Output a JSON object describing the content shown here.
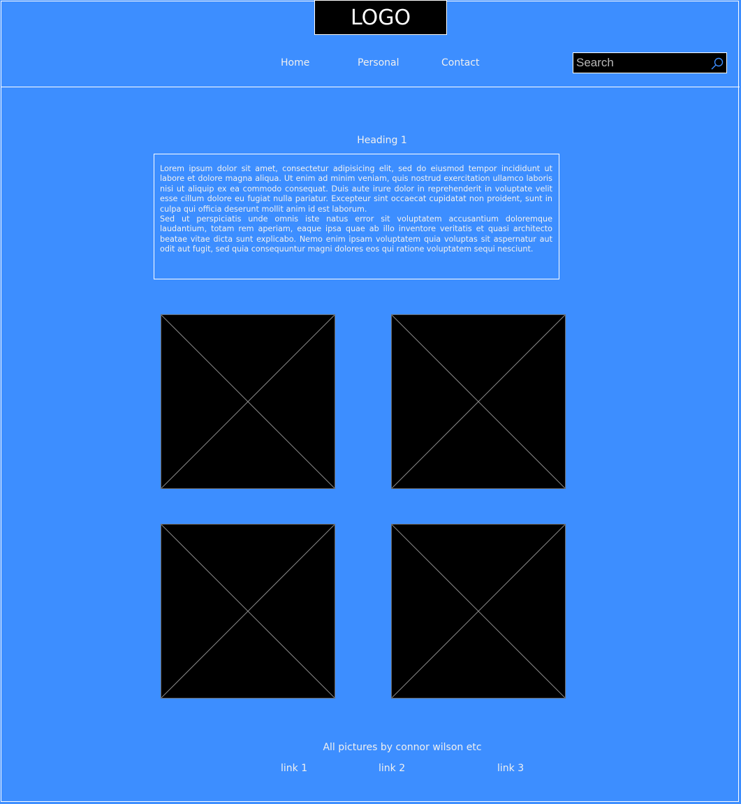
{
  "header": {
    "logo_text": "LOGO",
    "nav": [
      {
        "label": "Home"
      },
      {
        "label": "Personal"
      },
      {
        "label": "Contact"
      }
    ],
    "search": {
      "placeholder": "Search",
      "value": ""
    }
  },
  "main": {
    "heading": "Heading 1",
    "paragraphs": [
      "Lorem ipsum dolor sit amet, consectetur adipisicing elit, sed do eiusmod tempor incididunt ut labore et dolore magna aliqua. Ut enim ad minim veniam, quis nostrud exercitation ullamco laboris nisi ut aliquip ex ea commodo consequat. Duis aute irure dolor in reprehenderit in voluptate velit esse cillum dolore eu fugiat nulla pariatur. Excepteur sint occaecat cupidatat non proident, sunt in culpa qui officia deserunt mollit anim id est laborum.",
      "Sed ut perspiciatis unde omnis iste natus error sit voluptatem accusantium doloremque laudantium, totam rem aperiam, eaque ipsa quae ab illo inventore veritatis et quasi architecto beatae vitae dicta sunt explicabo. Nemo enim ipsam voluptatem quia voluptas sit aspernatur aut odit aut fugit, sed quia consequuntur magni dolores eos qui ratione voluptatem sequi nesciunt."
    ]
  },
  "footer": {
    "credit": "All pictures by connor wilson etc",
    "links": [
      {
        "label": "link 1"
      },
      {
        "label": "link 2"
      },
      {
        "label": "link 3"
      }
    ]
  },
  "colors": {
    "background": "#3d8eff",
    "placeholder_fill": "#000000",
    "line": "#ffffff",
    "search_icon": "#3d8eff"
  },
  "icons": {
    "search": "search-icon",
    "image_placeholder": "image-placeholder-x"
  }
}
